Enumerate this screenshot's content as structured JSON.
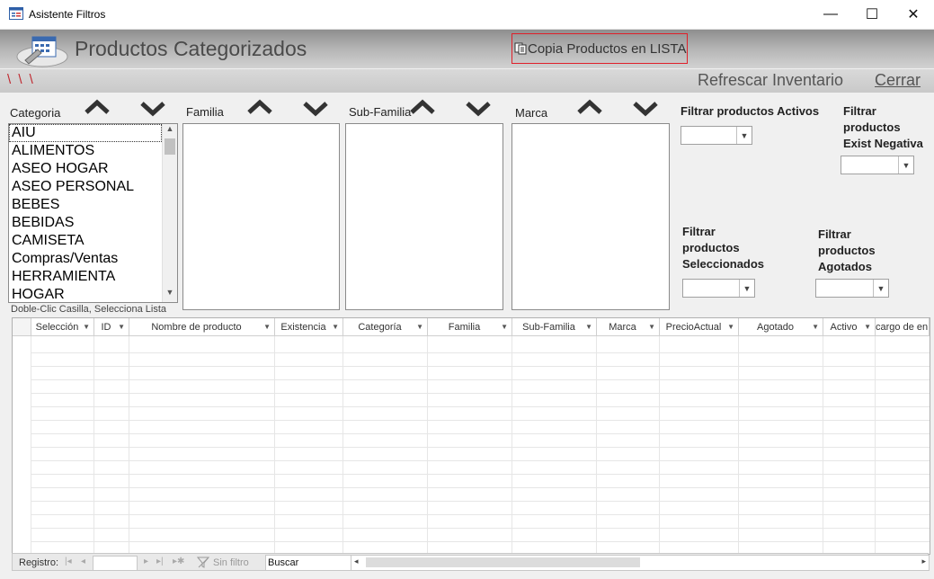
{
  "window": {
    "title": "Asistente Filtros",
    "minimize": "—",
    "maximize": "☐",
    "close": "✕"
  },
  "header": {
    "title": "Productos Categorizados",
    "copy_button": "Copia Productos en LISTA",
    "copy_icon": "copy-icon"
  },
  "toolbar": {
    "marks": "\\ \\ \\",
    "refresh": "Refrescar Inventario",
    "close": "Cerrar"
  },
  "filters": {
    "categoria_label": "Categoria",
    "familia_label": "Familia",
    "subfamilia_label": "Sub-Familia",
    "marca_label": "Marca",
    "categorias": [
      "AIU",
      "ALIMENTOS",
      "ASEO HOGAR",
      "ASEO PERSONAL",
      "BEBES",
      "BEBIDAS",
      "CAMISETA",
      "Compras/Ventas",
      "HERRAMIENTA",
      "HOGAR"
    ],
    "hint": "Doble-Clic Casilla, Selecciona Lista",
    "activos_label": "Filtrar productos Activos",
    "exist_neg_label": [
      "Filtrar",
      "productos",
      "Exist Negativa"
    ],
    "seleccionados_label": [
      "Filtrar",
      "productos",
      "Seleccionados"
    ],
    "agotados_label": [
      "Filtrar",
      "productos",
      "Agotados"
    ]
  },
  "grid": {
    "columns": [
      "Selección",
      "ID",
      "Nombre de producto",
      "Existencia",
      "Categoría",
      "Familia",
      "Sub-Familia",
      "Marca",
      "PrecioActual",
      "Agotado",
      "Activo",
      "cargo de en"
    ]
  },
  "navigation": {
    "record_label": "Registro:",
    "filter_label": "Sin filtro",
    "search_placeholder": "Buscar"
  },
  "colors": {
    "accent_border": "#e0202a",
    "chevron": "#333333"
  }
}
